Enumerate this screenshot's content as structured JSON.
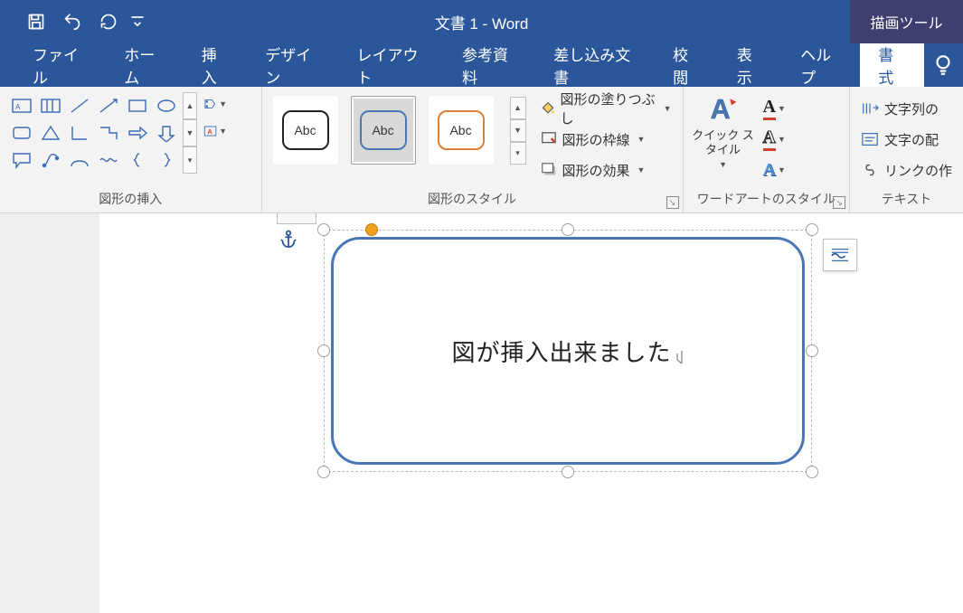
{
  "title": "文書 1  -  Word",
  "contextual_tab": "描画ツール",
  "tabs": [
    "ファイル",
    "ホーム",
    "挿入",
    "デザイン",
    "レイアウト",
    "参考資料",
    "差し込み文書",
    "校閲",
    "表示",
    "ヘルプ",
    "書式"
  ],
  "active_tab_index": 10,
  "ribbon": {
    "group_shapes_label": "図形の挿入",
    "group_styles_label": "図形のスタイル",
    "group_wordart_label": "ワードアートのスタイル",
    "group_text_label": "テキスト",
    "style_thumb_label": "Abc",
    "fill_label": "図形の塗りつぶし",
    "outline_label": "図形の枠線",
    "effects_label": "図形の効果",
    "quickstyle_label": "クイック\nスタイル",
    "text_direction": "文字列の",
    "text_align": "文字の配",
    "create_link": "リンクの作"
  },
  "shape_text": "図が挿入出来ました"
}
